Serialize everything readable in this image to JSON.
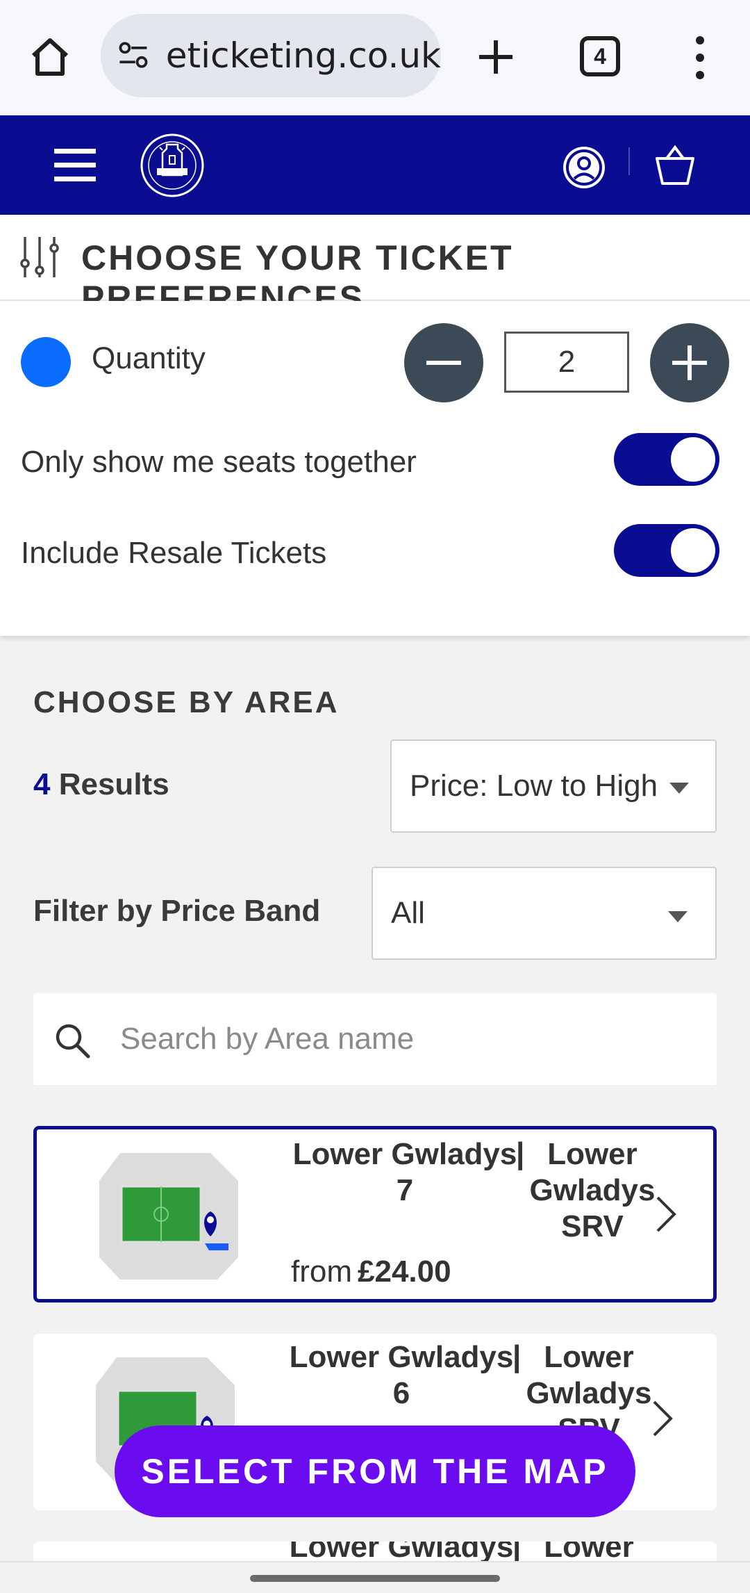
{
  "browser": {
    "url": "eticketing.co.uk",
    "tab_count": "4"
  },
  "header": {
    "brand": "Everton",
    "brand_color": "#0a0c91"
  },
  "preferences": {
    "title": "CHOOSE YOUR TICKET PREFERENCES",
    "quantity_label": "Quantity",
    "quantity_value": "2",
    "seats_together_label": "Only show me seats together",
    "seats_together_on": true,
    "resale_label": "Include Resale Tickets",
    "resale_on": true
  },
  "area": {
    "heading": "CHOOSE BY AREA",
    "results_count": "4",
    "results_word": "Results",
    "sort_value": "Price: Low to High",
    "price_band_label": "Filter by Price Band",
    "price_band_value": "All",
    "search_placeholder": "Search by Area name"
  },
  "cards": [
    {
      "name_line1": "Lower Gwladys",
      "name_line2": "7",
      "stand_line1": "Lower",
      "stand_line2": "Gwladys",
      "stand_line3": "SRV",
      "from_label": "from",
      "price": "£24.00"
    },
    {
      "name_line1": "Lower Gwladys",
      "name_line2": "6",
      "stand_line1": "Lower",
      "stand_line2": "Gwladys",
      "stand_line3": "SRV",
      "from_label": "from",
      "price": ""
    },
    {
      "name_line1": "Lower Gwladys",
      "stand_line1": "Lower"
    }
  ],
  "map_button_label": "SELECT FROM THE MAP",
  "colors": {
    "accent_purple": "#6a0bf0",
    "quantity_dot": "#0a6cff"
  }
}
